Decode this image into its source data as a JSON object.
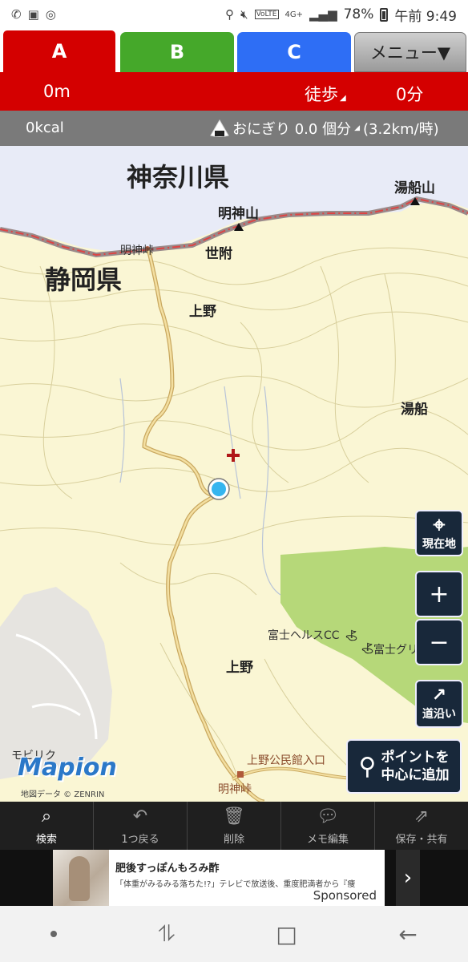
{
  "status_bar": {
    "battery": "78%",
    "network": "4G+",
    "volte": "VoLTE",
    "time": "午前 9:49"
  },
  "tabs": [
    {
      "label": "A",
      "color": "#d40000",
      "selected": true
    },
    {
      "label": "B",
      "color": "#45a82a",
      "selected": false
    },
    {
      "label": "C",
      "color": "#2e6ef5",
      "selected": false
    },
    {
      "label": "メニュー▼",
      "selected": false
    }
  ],
  "route": {
    "distance": "0m",
    "mode": "徒歩",
    "time": "0分"
  },
  "info": {
    "kcal": "0kcal",
    "onigiri": "おにぎり 0.0 個分",
    "speed": "(3.2km/時)"
  },
  "map": {
    "labels": {
      "kanagawa": "神奈川県",
      "shizuoka": "静岡県",
      "myojinyama": "明神山",
      "yubuneyama": "湯船山",
      "myojintoge": "明神峠",
      "sefu": "世附",
      "ueno_top": "上野",
      "yubune": "湯船",
      "fuji_health": "富士ヘルスCC",
      "fuji_gu": "富士グリ",
      "ueno_bottom": "上野",
      "ueno_kominkan": "上野公民館入口",
      "myojintoge_bottom": "明神峠",
      "morizuka": "モビリク"
    },
    "logo": "Mapion",
    "attribution": "地図データ © ZENRIN",
    "buttons": {
      "current_location": "現在地",
      "zoom_in": "+",
      "zoom_out": "−",
      "along_road": "道沿い",
      "add_point_line1": "ポイントを",
      "add_point_line2": "中心に追加"
    }
  },
  "toolbar": [
    {
      "label": "検索",
      "icon": "search-icon",
      "active": true
    },
    {
      "label": "1つ戻る",
      "icon": "undo-icon",
      "active": false
    },
    {
      "label": "削除",
      "icon": "trash-icon",
      "active": false
    },
    {
      "label": "メモ編集",
      "icon": "memo-icon",
      "active": false
    },
    {
      "label": "保存・共有",
      "icon": "share-icon",
      "active": false
    }
  ],
  "ad": {
    "title": "肥後すっぽんもろみ酢",
    "description": "「体重がみるみる落ちた!?」テレビで放送後、重度肥満者から『痩",
    "sponsored": "Sponsored",
    "arrow": "›"
  },
  "nav": {
    "recent": "⥮",
    "home": "□",
    "back": "←"
  }
}
